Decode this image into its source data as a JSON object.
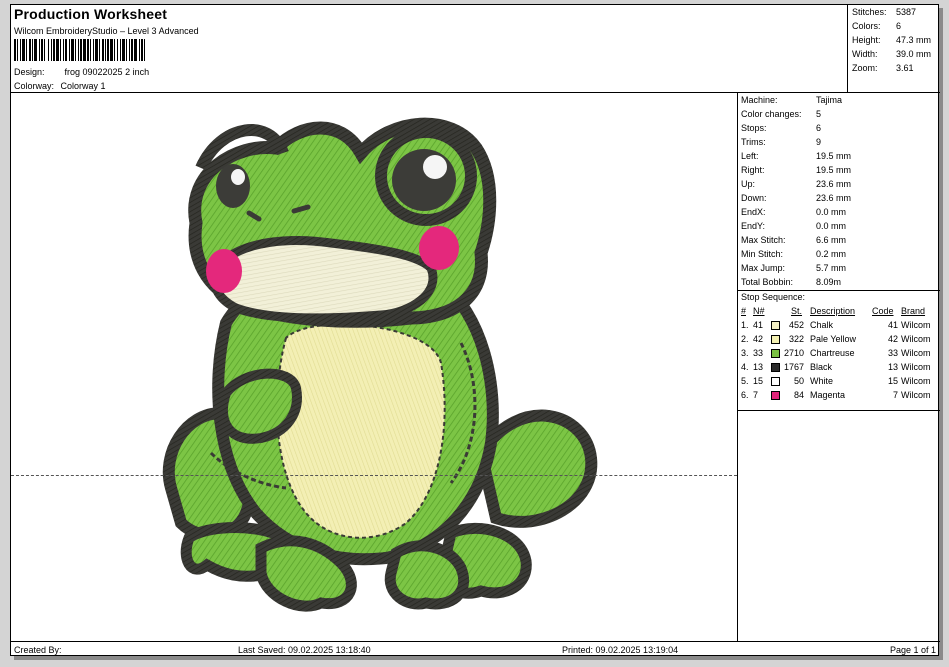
{
  "header": {
    "title": "Production Worksheet",
    "subtitle": "Wilcom EmbroideryStudio – Level 3 Advanced",
    "design_label": "Design:",
    "design_value": "frog 09022025 2 inch",
    "colorway_label": "Colorway:",
    "colorway_value": "Colorway 1"
  },
  "summary": [
    {
      "label": "Stitches:",
      "value": "5387"
    },
    {
      "label": "Colors:",
      "value": "6"
    },
    {
      "label": "Height:",
      "value": "47.3 mm"
    },
    {
      "label": "Width:",
      "value": "39.0 mm"
    },
    {
      "label": "Zoom:",
      "value": "3.61"
    }
  ],
  "machine_info": [
    {
      "label": "Machine:",
      "value": "Tajima"
    },
    {
      "label": "Color changes:",
      "value": "5"
    },
    {
      "label": "Stops:",
      "value": "6"
    },
    {
      "label": "Trims:",
      "value": "9"
    },
    {
      "label": "Left:",
      "value": "19.5 mm"
    },
    {
      "label": "Right:",
      "value": "19.5 mm"
    },
    {
      "label": "Up:",
      "value": "23.6 mm"
    },
    {
      "label": "Down:",
      "value": "23.6 mm"
    },
    {
      "label": "EndX:",
      "value": "0.0 mm"
    },
    {
      "label": "EndY:",
      "value": "0.0 mm"
    },
    {
      "label": "Max Stitch:",
      "value": "6.6 mm"
    },
    {
      "label": "Min Stitch:",
      "value": "0.2 mm"
    },
    {
      "label": "Max Jump:",
      "value": "5.7 mm"
    },
    {
      "label": "Total Bobbin:",
      "value": "8.09m"
    }
  ],
  "stop_sequence": {
    "title": "Stop Sequence:",
    "headers": {
      "num": "#",
      "n": "N#",
      "st": "St.",
      "description": "Description",
      "code": "Code",
      "brand": "Brand"
    },
    "rows": [
      {
        "idx": "1.",
        "n": "41",
        "color": "#f3efc4",
        "st": "452",
        "description": "Chalk",
        "code": "41",
        "brand": "Wilcom"
      },
      {
        "idx": "2.",
        "n": "42",
        "color": "#f4f1b3",
        "st": "322",
        "description": "Pale Yellow",
        "code": "42",
        "brand": "Wilcom"
      },
      {
        "idx": "3.",
        "n": "33",
        "color": "#7ac143",
        "st": "2710",
        "description": "Chartreuse",
        "code": "33",
        "brand": "Wilcom"
      },
      {
        "idx": "4.",
        "n": "13",
        "color": "#2b2b2b",
        "st": "1767",
        "description": "Black",
        "code": "13",
        "brand": "Wilcom"
      },
      {
        "idx": "5.",
        "n": "15",
        "color": "#ffffff",
        "st": "50",
        "description": "White",
        "code": "15",
        "brand": "Wilcom"
      },
      {
        "idx": "6.",
        "n": "7",
        "color": "#e0247a",
        "st": "84",
        "description": "Magenta",
        "code": "7",
        "brand": "Wilcom"
      }
    ]
  },
  "footer": {
    "created_by": "Created By:",
    "last_saved": "Last Saved: 09.02.2025 13:18:40",
    "printed": "Printed: 09.02.2025 13:19:04",
    "page": "Page 1 of 1"
  },
  "colors": {
    "thread_green": "#76c043",
    "thread_outline": "#3a3a36",
    "thread_chalk": "#f1efcf",
    "thread_pale_yellow": "#f2eeb0",
    "thread_magenta": "#e4287c"
  }
}
